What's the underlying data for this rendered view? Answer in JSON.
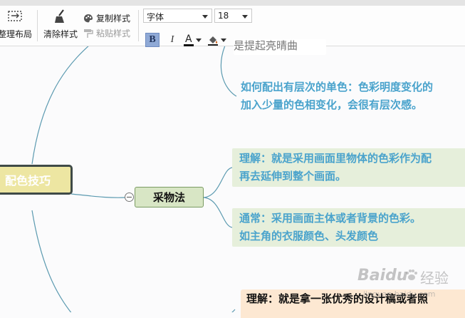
{
  "toolbar": {
    "layout_label": "整理布局",
    "clear_style_label": "清除样式",
    "copy_style_label": "复制样式",
    "paste_style_label": "粘贴样式",
    "font_value": "字体",
    "size_value": "18",
    "bold_label": "B",
    "italic_label": "I",
    "font_color_label": "A"
  },
  "mindmap": {
    "root_label": "配色技巧",
    "branch_label": "采物法",
    "top_partial": "是提起亮晴曲",
    "top_note": [
      "如何配出有层次的单色：色彩明度变化的",
      "加入少量的色相变化，会很有层次感。"
    ],
    "note1": [
      "理解：就是采用画面里物体的色彩作为配",
      "再去延伸到整个画面。"
    ],
    "note2": [
      "通常：采用画面主体或者背景的色彩。",
      "如主角的衣服颜色、头发颜色"
    ],
    "note3": "理解：就是拿一张优秀的设计稿或者照"
  },
  "watermark": {
    "brand": "Baidu",
    "cn": "经验",
    "url": "jingyan.baidu.com"
  },
  "colors": {
    "root_fill": "#ede6a2",
    "root_border": "#3f4a47",
    "branch_fill": "#d8e6c5",
    "branch_border": "#7a9b62",
    "note_fill": "#e6efdb",
    "blue_text": "#4aa3cc",
    "orange_fill": "#fde8d2",
    "line": "#5b9ab0"
  }
}
